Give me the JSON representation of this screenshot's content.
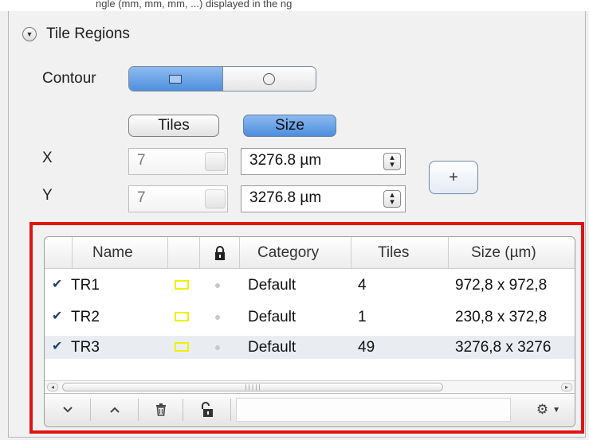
{
  "tile_regions": {
    "header": "Tile Regions",
    "contour_label": "Contour",
    "contour_options": [
      "rectangle",
      "circle"
    ],
    "contour_selected": "rectangle",
    "mode_tiles": "Tiles",
    "mode_size": "Size",
    "mode_selected": "Size",
    "x_label": "X",
    "y_label": "Y",
    "x_tiles": "7",
    "y_tiles": "7",
    "x_size": "3276.8 µm",
    "y_size": "3276.8 µm",
    "add_label": "+"
  },
  "table": {
    "columns": [
      "Name",
      "",
      "",
      "Category",
      "Tiles",
      "Size (µm)"
    ],
    "rows": [
      {
        "checked": true,
        "name": "TR1",
        "category": "Default",
        "tiles": "4",
        "size": "972,8 x 972,8"
      },
      {
        "checked": true,
        "name": "TR2",
        "category": "Default",
        "tiles": "1",
        "size": "230,8 x 372,8"
      },
      {
        "checked": true,
        "name": "TR3",
        "category": "Default",
        "tiles": "49",
        "size": "3276,8 x 3276"
      }
    ],
    "region_color": "#f0f000"
  },
  "toolbar": {
    "icons": [
      "chevron-down-icon",
      "chevron-up-icon",
      "trash-icon",
      "unlock-icon",
      "gear-icon"
    ]
  },
  "colors": {
    "accent": "#4f8fde",
    "highlight": "#e01414"
  },
  "top_strip_text": "ngle (mm, mm, mm, ...) displayed in the ng"
}
